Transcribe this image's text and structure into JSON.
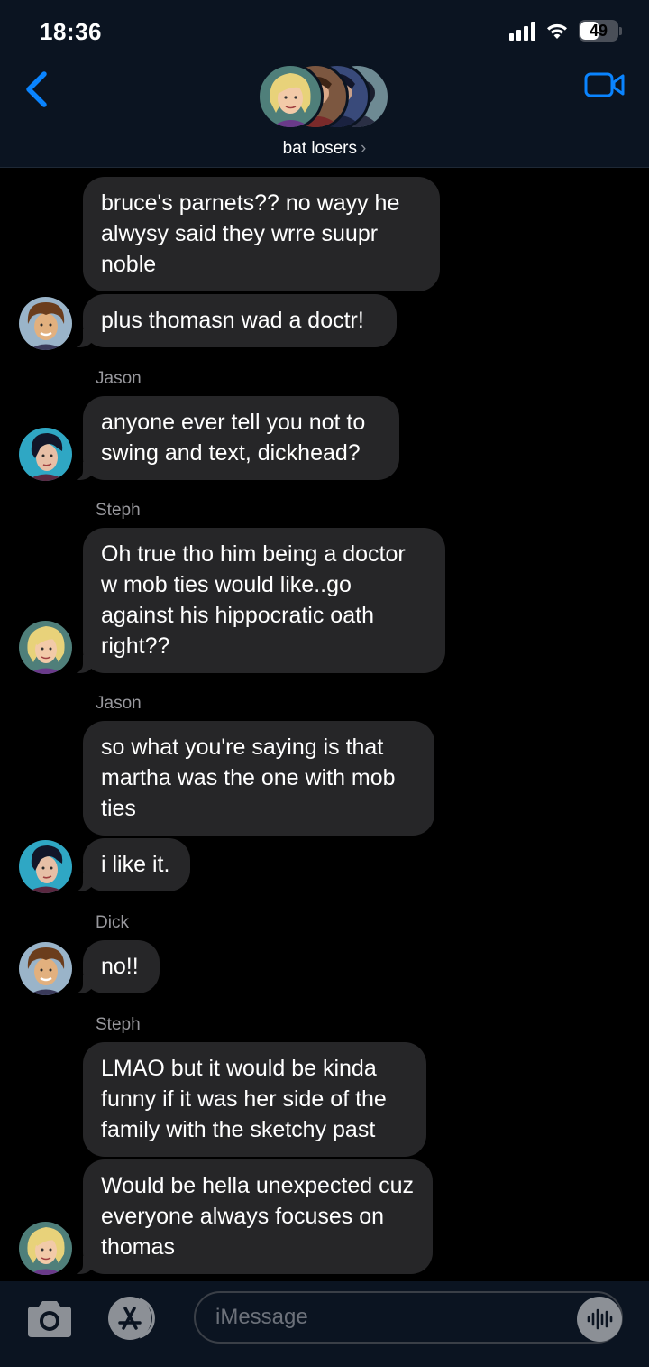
{
  "status_bar": {
    "time": "18:36",
    "battery": "49"
  },
  "header": {
    "group_name": "bat losers",
    "chevron": "›"
  },
  "messages": [
    {
      "text": "bruce's parnets?? no wayy he alwysy said they wrre suupr noble"
    },
    {
      "text": "plus thomasn wad a doctr!"
    },
    {
      "sender": "Jason"
    },
    {
      "text": "anyone ever tell you not to swing and text, dickhead?"
    },
    {
      "sender": "Steph"
    },
    {
      "text": "Oh true tho him being a doctor w mob ties would like..go against his hippocratic oath right??"
    },
    {
      "sender": "Jason"
    },
    {
      "text": "so what you're saying is that martha was the one with mob ties"
    },
    {
      "text": "i like it."
    },
    {
      "sender": "Dick"
    },
    {
      "text": "no!!"
    },
    {
      "sender": "Steph"
    },
    {
      "text": "LMAO but it would be kinda funny if it was her side of the family with the sketchy past"
    },
    {
      "text": "Would be hella unexpected cuz everyone always focuses on thomas"
    }
  ],
  "input": {
    "placeholder": "iMessage"
  },
  "icons": {
    "back": "chevron-left-icon",
    "video": "video-camera-icon",
    "camera": "camera-icon",
    "apps": "app-store-icon",
    "audio": "waveform-icon"
  },
  "colors": {
    "accent": "#0a84ff",
    "bubble": "#262628",
    "header_bg": "#0b1421",
    "sender_label": "#98989d"
  }
}
